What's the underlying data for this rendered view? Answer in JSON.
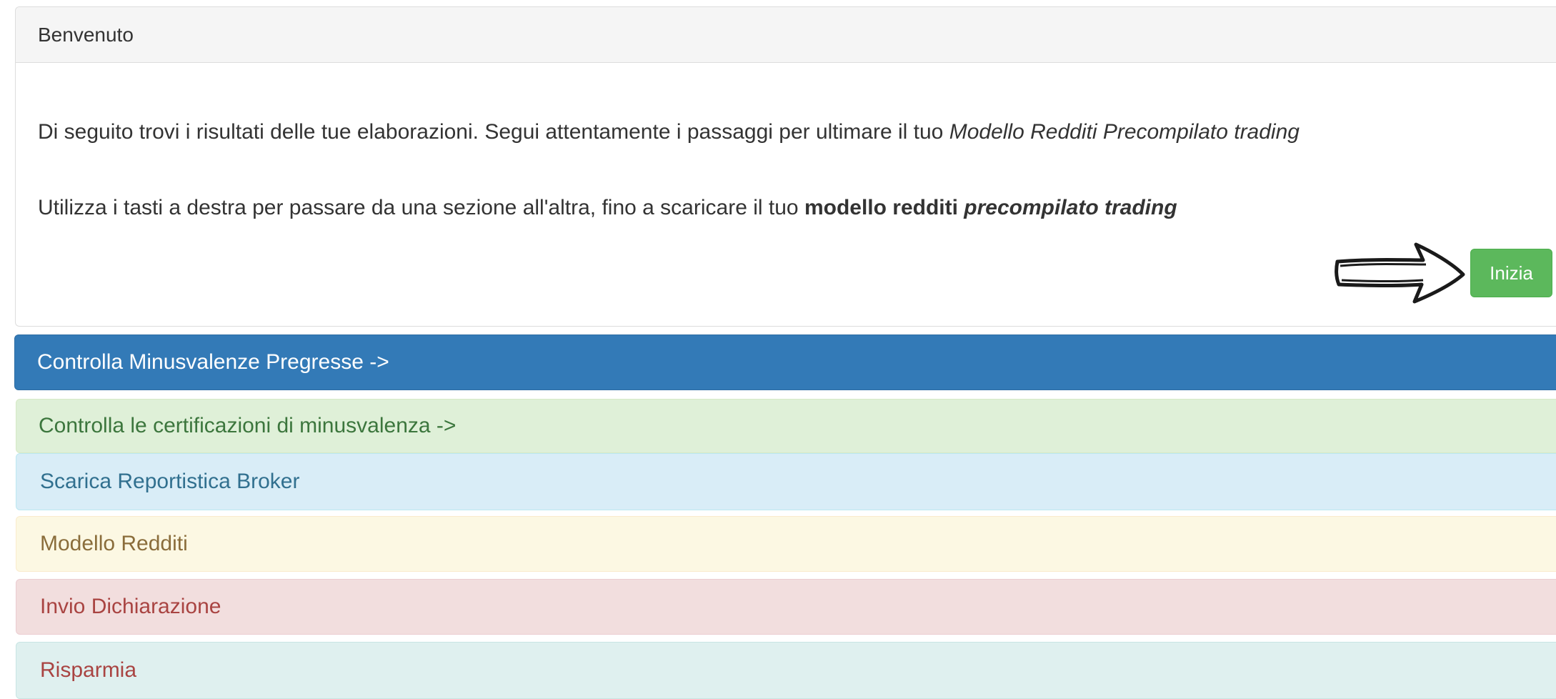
{
  "welcome": {
    "heading": "Benvenuto",
    "line1_text": "Di seguito trovi i risultati delle tue elaborazioni. Segui attentamente i passaggi per ultimare il tuo ",
    "line1_emphasis": "Modello Redditi Precompilato trading",
    "line2_text": "Utilizza i tasti a destra per passare da una sezione all'altra, fino a scaricare il tuo ",
    "line2_bold": "modello redditi ",
    "line2_bold_italic": "precompilato trading",
    "start_button_label": "Inizia"
  },
  "sections": {
    "minusvalenze": "Controlla Minusvalenze Pregresse ->",
    "certificazioni": "Controlla le certificazioni di minusvalenza ->",
    "reportistica": "Scarica Reportistica Broker",
    "modello": "Modello Redditi",
    "invio": "Invio Dichiarazione",
    "risparmia": "Risparmia"
  },
  "colors": {
    "primary": "#337ab7",
    "success": "#5cb85c",
    "success_bg": "#dff0d8",
    "info_bg": "#d9edf7",
    "warning_bg": "#fcf8e3",
    "danger_bg": "#f2dede",
    "teal_bg": "#dff0ef"
  },
  "icons": {
    "arrow": "arrow-right-icon"
  }
}
